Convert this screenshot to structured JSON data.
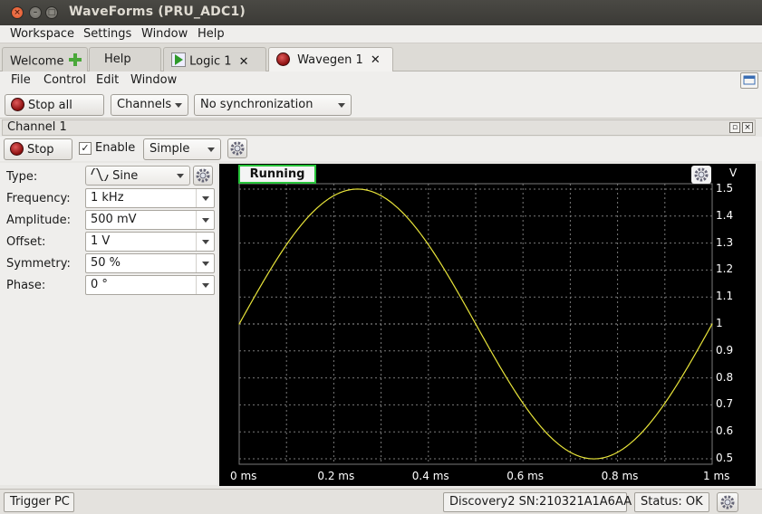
{
  "window": {
    "title": "WaveForms  (PRU_ADC1)"
  },
  "menubar": {
    "items": [
      "Workspace",
      "Settings",
      "Window",
      "Help"
    ]
  },
  "tabs": [
    {
      "label": "Welcome",
      "icon": "plus-icon"
    },
    {
      "label": "Help"
    },
    {
      "label": "Logic 1",
      "icon": "play-icon"
    },
    {
      "label": "Wavegen 1",
      "icon": "stop-icon",
      "active": true
    }
  ],
  "submenu": {
    "items": [
      "File",
      "Control",
      "Edit",
      "Window"
    ]
  },
  "toolbar": {
    "stop_all": "Stop all",
    "channels": "Channels",
    "sync": "No synchronization"
  },
  "channel": {
    "header": "Channel 1",
    "stop": "Stop",
    "enable_label": "Enable",
    "enabled": true,
    "mode": "Simple"
  },
  "params": [
    {
      "label": "Type:",
      "value": "Sine"
    },
    {
      "label": "Frequency:",
      "value": "1 kHz"
    },
    {
      "label": "Amplitude:",
      "value": "500 mV"
    },
    {
      "label": "Offset:",
      "value": "1 V"
    },
    {
      "label": "Symmetry:",
      "value": "50 %"
    },
    {
      "label": "Phase:",
      "value": "0 °"
    }
  ],
  "plot": {
    "status": "Running",
    "unit": "V",
    "colors": {
      "background": "#000000",
      "trace": "#e8e43a",
      "grid": "#7a7a7a",
      "status_border": "#27c43a"
    }
  },
  "chart_data": {
    "type": "line",
    "xlabel": "",
    "ylabel": "V",
    "x_ticks": [
      "0 ms",
      "0.2 ms",
      "0.4 ms",
      "0.6 ms",
      "0.8 ms",
      "1 ms"
    ],
    "y_ticks": [
      "1.5",
      "1.4",
      "1.3",
      "1.2",
      "1.1",
      "1",
      "0.9",
      "0.8",
      "0.7",
      "0.6",
      "0.5"
    ],
    "xlim": [
      0,
      1
    ],
    "ylim": [
      0.48,
      1.52
    ],
    "grid": true,
    "series": [
      {
        "x": [
          0,
          0.05,
          0.1,
          0.15,
          0.2,
          0.25,
          0.3,
          0.35,
          0.4,
          0.45,
          0.5,
          0.55,
          0.6,
          0.65,
          0.7,
          0.75,
          0.8,
          0.85,
          0.9,
          0.95,
          1.0
        ],
        "values": [
          1.0,
          1.155,
          1.294,
          1.405,
          1.476,
          1.5,
          1.476,
          1.405,
          1.294,
          1.155,
          1.0,
          0.845,
          0.706,
          0.595,
          0.524,
          0.5,
          0.524,
          0.595,
          0.706,
          0.845,
          1.0
        ]
      }
    ]
  },
  "statusbar": {
    "trigger": "Trigger PC",
    "device": "Discovery2 SN:210321A1A6AA",
    "status": "Status: OK"
  }
}
